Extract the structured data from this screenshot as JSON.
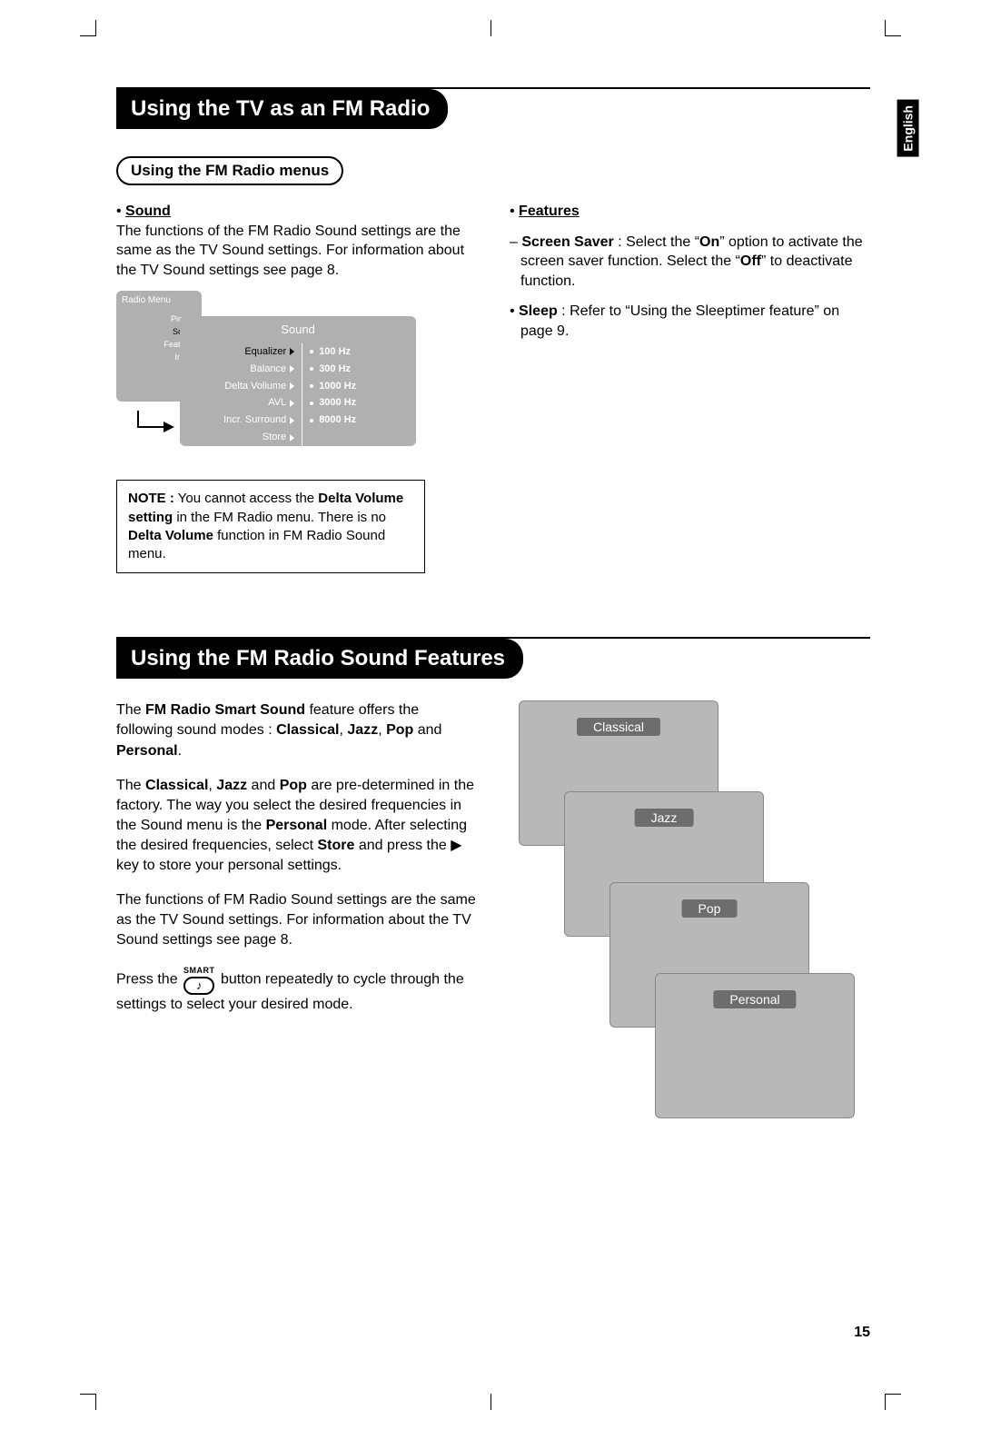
{
  "language_tab": "English",
  "page_number": "15",
  "section1": {
    "title": "Using the TV as an FM Radio",
    "subtitle": "Using the FM Radio menus",
    "sound": {
      "label": "Sound",
      "text": "The functions of the FM Radio Sound settings are the same as the TV Sound settings. For information about the TV Sound settings see page 8."
    },
    "features": {
      "label": "Features",
      "screen_saver_lead": "Screen Saver",
      "screen_saver_text_a": " : Select the “",
      "on": "On",
      "screen_saver_text_b": "” option to activate the screen saver function. Select the “",
      "off": "Off",
      "screen_saver_text_c": "” to deactivate function.",
      "sleep_lead": "Sleep",
      "sleep_text": " : Refer to “Using the Sleeptimer feature” on page 9."
    },
    "osd": {
      "back_title": "Radio Menu",
      "back_items": [
        "Picture",
        "Sound",
        "Features",
        "Install"
      ],
      "back_selected_index": 1,
      "front_title": "Sound",
      "left_items": [
        "Equalizer",
        "Balance",
        "Delta Voliume",
        "AVL",
        "Incr. Surround",
        "Store"
      ],
      "left_selected_index": 0,
      "right_items": [
        "100 Hz",
        "300 Hz",
        "1000 Hz",
        "3000 Hz",
        "8000 Hz"
      ]
    },
    "note": {
      "lead": "NOTE :",
      "text_a": " You cannot access the ",
      "bold_a": "Delta Volume setting",
      "text_b": " in the FM Radio menu. There is no ",
      "bold_b": "Delta Volume",
      "text_c": " function in FM Radio Sound menu."
    }
  },
  "section2": {
    "title": "Using the FM Radio Sound Features",
    "p1_a": "The ",
    "p1_b": "FM Radio Smart Sound",
    "p1_c": " feature offers the following sound modes : ",
    "p1_d": "Classical",
    "p1_e": ", ",
    "p1_f": "Jazz",
    "p1_g": ", ",
    "p1_h": "Pop",
    "p1_i": " and ",
    "p1_j": "Personal",
    "p1_k": ".",
    "p2_a": "The ",
    "p2_b": "Classical",
    "p2_c": ", ",
    "p2_d": "Jazz",
    "p2_e": " and ",
    "p2_f": "Pop",
    "p2_g": " are pre-determined in the factory. The way you select the desired frequencies in the Sound menu is the ",
    "p2_h": "Personal",
    "p2_i": " mode. After selecting the desired frequencies, select ",
    "p2_j": "Store",
    "p2_k": " and press the ▶ key to store your personal settings.",
    "p3": "The functions of FM Radio Sound settings are the same as the TV Sound settings. For information about the TV Sound settings see page 8.",
    "p4_a": "Press the ",
    "p4_button_label": "SMART",
    "p4_b": " button repeatedly to cycle through the settings to select your desired mode.",
    "modes": [
      "Classical",
      "Jazz",
      "Pop",
      "Personal"
    ]
  }
}
